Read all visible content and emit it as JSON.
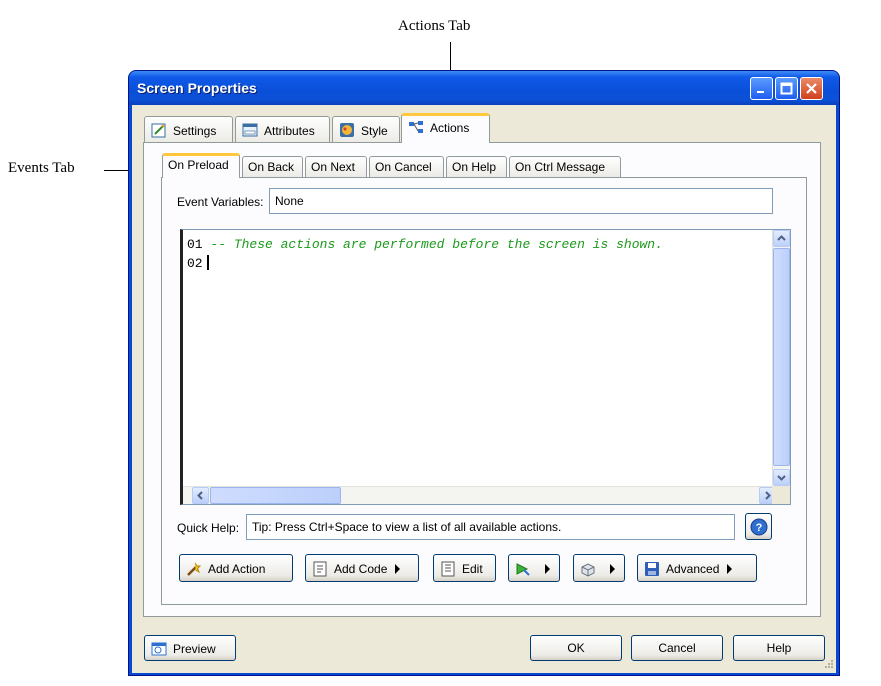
{
  "callouts": {
    "actions_tab": "Actions Tab",
    "events_tab": "Events Tab"
  },
  "window": {
    "title": "Screen Properties"
  },
  "outer_tabs": [
    "Settings",
    "Attributes",
    "Style",
    "Actions"
  ],
  "event_tabs": [
    "On Preload",
    "On Back",
    "On Next",
    "On Cancel",
    "On Help",
    "On Ctrl Message"
  ],
  "event_variables": {
    "label": "Event Variables:",
    "value": "None"
  },
  "editor": {
    "line_numbers": [
      "01",
      "02"
    ],
    "line1": "-- These actions are performed before the screen is shown.",
    "line2": ""
  },
  "quick_help": {
    "label": "Quick Help:",
    "value": "Tip: Press Ctrl+Space to view a list of all available actions."
  },
  "toolbar": {
    "add_action": "Add Action",
    "add_code": "Add Code",
    "edit": "Edit",
    "advanced": "Advanced"
  },
  "footer": {
    "preview": "Preview",
    "ok": "OK",
    "cancel": "Cancel",
    "help": "Help"
  },
  "colors": {
    "titlebar": "#0a4fd8",
    "dialog_bg": "#ece9d8",
    "active_tab_accent": "#ffc83c",
    "comment": "#1c9b1c"
  },
  "icons": [
    "settings-icon",
    "attributes-icon",
    "style-icon",
    "actions-icon",
    "add-action-icon",
    "add-code-icon",
    "edit-icon",
    "play-icon",
    "package-icon",
    "save-icon",
    "preview-icon",
    "help-circle-icon"
  ]
}
